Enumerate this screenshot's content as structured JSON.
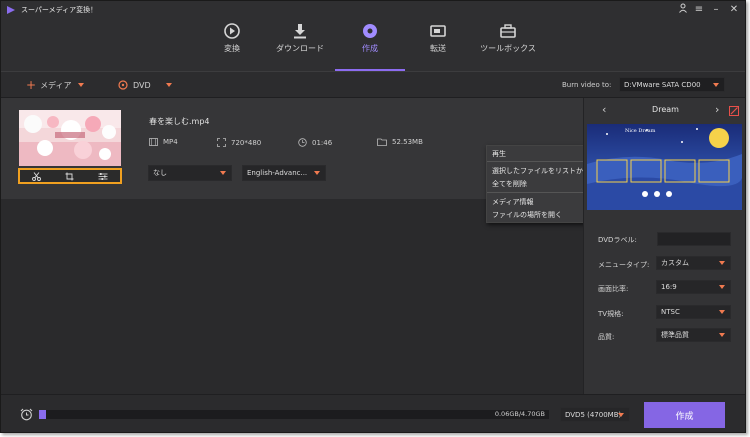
{
  "app": {
    "title": "スーパーメディア変換！"
  },
  "nav": {
    "tabs": [
      {
        "label": "変換",
        "icon": "convert-icon"
      },
      {
        "label": "ダウンロード",
        "icon": "download-icon"
      },
      {
        "label": "作成",
        "icon": "create-disc-icon",
        "active": true
      },
      {
        "label": "転送",
        "icon": "transfer-icon"
      },
      {
        "label": "ツールボックス",
        "icon": "toolbox-icon"
      }
    ]
  },
  "toolbar": {
    "add_media_label": "メディア",
    "dvd_label": "DVD",
    "burn_label": "Burn video to:",
    "burn_target": "D:VMware SATA CD00"
  },
  "item": {
    "filename": "春を楽しむ.mp4",
    "format": "MP4",
    "resolution": "720*480",
    "duration": "01:46",
    "size": "52.53MB",
    "subtitle_select": "なし",
    "audio_select": "English-Advanc..."
  },
  "context_menu": {
    "items": [
      "再生",
      "選択したファイルをリストから削除",
      "全てを削除",
      "メディア情報",
      "ファイルの場所を開く"
    ]
  },
  "template": {
    "name": "Dream",
    "preview_title": "Nice Dream"
  },
  "properties": {
    "dvd_label": {
      "label": "DVDラベル:",
      "value": ""
    },
    "menu_type": {
      "label": "メニュータイプ:",
      "value": "カスタム"
    },
    "aspect_ratio": {
      "label": "画面比率:",
      "value": "16:9"
    },
    "tv_standard": {
      "label": "TV規格:",
      "value": "NTSC"
    },
    "quality": {
      "label": "品質:",
      "value": "標準品質"
    }
  },
  "bottom": {
    "progress_text": "0.06GB/4.70GB",
    "progress_fraction": 0.013,
    "disc_type": "DVD5 (4700MB)",
    "create_label": "作成"
  },
  "colors": {
    "accent": "#8566e4",
    "highlight": "#f0a020",
    "caret": "#f07a50"
  }
}
